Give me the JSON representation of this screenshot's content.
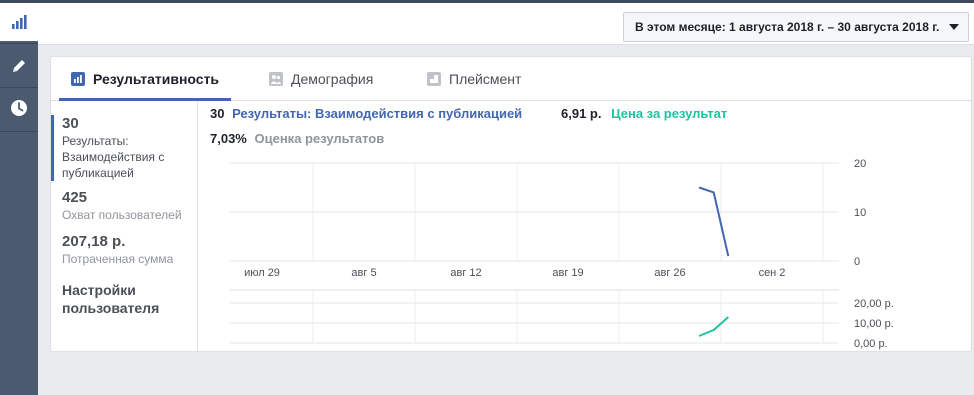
{
  "header": {
    "date_range": "В этом месяце: 1 августа 2018 г. – 30 августа 2018 г."
  },
  "rail": {
    "icons": [
      "bar-chart-icon",
      "pencil-icon",
      "clock-icon"
    ]
  },
  "tabs": [
    {
      "label": "Результативность",
      "icon": "bar-chart-icon",
      "active": true
    },
    {
      "label": "Демография",
      "icon": "people-icon",
      "active": false
    },
    {
      "label": "Плейсмент",
      "icon": "placement-icon",
      "active": false
    }
  ],
  "metrics": [
    {
      "value": "30",
      "label": "Результаты: Взаимодействия с публикацией"
    },
    {
      "value": "425",
      "label": "Охват пользователей"
    },
    {
      "value": "207,18 р.",
      "label": "Потраченная сумма"
    }
  ],
  "settings_label": "Настройки пользователя",
  "summary": {
    "results_value": "30",
    "results_label": "Результаты: Взаимодействия с публикацией",
    "cost_value": "6,91 р.",
    "cost_label": "Цена за результат",
    "rate_value": "7,03%",
    "rate_label": "Оценка результатов"
  },
  "colors": {
    "results": "#4267b2",
    "cost": "#1fc2a0"
  },
  "chart_data": [
    {
      "type": "line",
      "x_tick_labels": [
        "июл 29",
        "авг 5",
        "авг 12",
        "авг 19",
        "авг 26",
        "сен 2"
      ],
      "y_tick_labels": [
        "20",
        "10",
        "0"
      ],
      "ylim": [
        0,
        20
      ],
      "series": [
        {
          "name": "Результаты: Взаимодействия с публикацией",
          "x": [
            "2018-08-28",
            "2018-08-29",
            "2018-08-30"
          ],
          "values": [
            15,
            14,
            1
          ]
        }
      ]
    },
    {
      "type": "line",
      "y_tick_labels": [
        "20,00 р.",
        "10,00 р.",
        "0,00 р."
      ],
      "ylim": [
        0,
        20
      ],
      "series": [
        {
          "name": "Цена за результат",
          "x": [
            "2018-08-28",
            "2018-08-29",
            "2018-08-30"
          ],
          "values": [
            3.5,
            6.5,
            13
          ]
        }
      ]
    }
  ]
}
